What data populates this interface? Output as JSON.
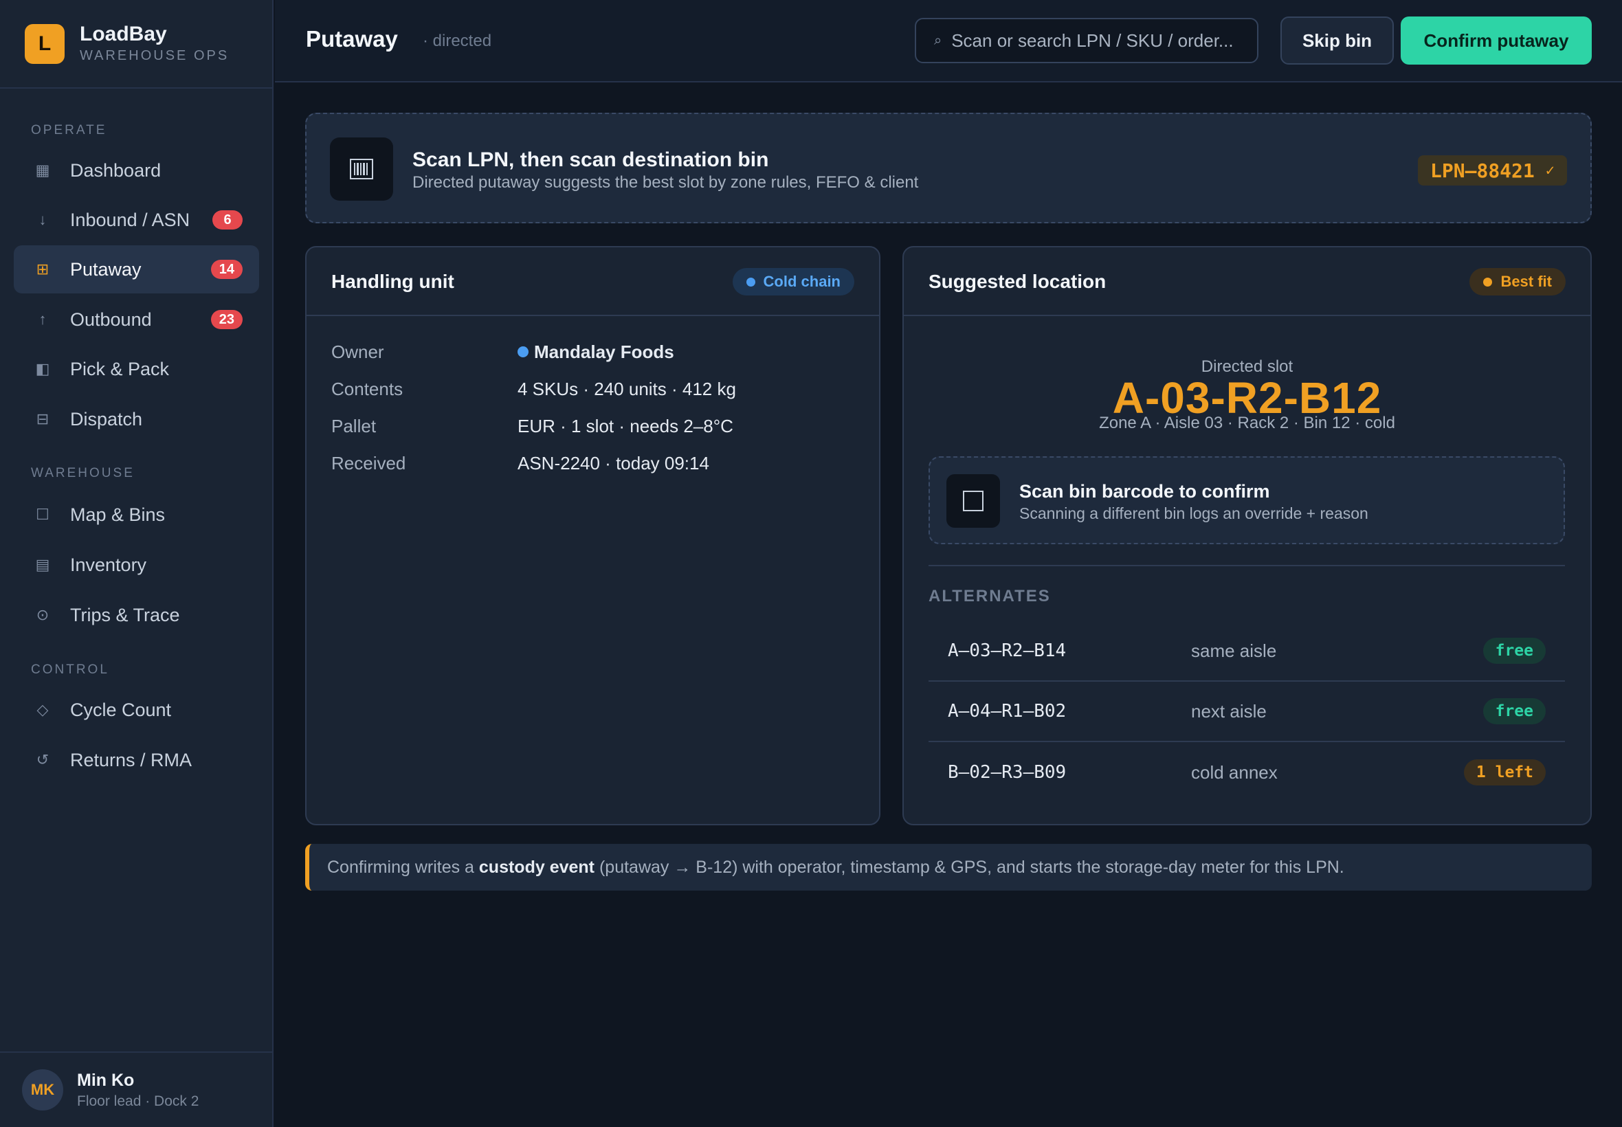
{
  "app": {
    "logo_letter": "L",
    "name": "LoadBay",
    "subtitle": "WAREHOUSE OPS"
  },
  "sidebar": {
    "sections": [
      {
        "label": "OPERATE"
      },
      {
        "label": "WAREHOUSE"
      },
      {
        "label": "CONTROL"
      }
    ],
    "items": [
      {
        "label": "Dashboard",
        "icon": "dashboard-icon",
        "glyph": "▦"
      },
      {
        "label": "Inbound / ASN",
        "icon": "arrow-down-icon",
        "glyph": "↓",
        "badge": "6"
      },
      {
        "label": "Putaway",
        "icon": "grid-icon",
        "glyph": "⊞",
        "badge": "14",
        "active": true
      },
      {
        "label": "Outbound",
        "icon": "arrow-up-icon",
        "glyph": "↑",
        "badge": "23"
      },
      {
        "label": "Pick & Pack",
        "icon": "box-icon",
        "glyph": "◧"
      },
      {
        "label": "Dispatch",
        "icon": "dispatch-icon",
        "glyph": "⊟"
      },
      {
        "label": "Map & Bins",
        "icon": "map-icon",
        "glyph": "☐"
      },
      {
        "label": "Inventory",
        "icon": "inventory-icon",
        "glyph": "▤"
      },
      {
        "label": "Trips & Trace",
        "icon": "trace-icon",
        "glyph": "⊙"
      },
      {
        "label": "Cycle Count",
        "icon": "diamond-icon",
        "glyph": "◇"
      },
      {
        "label": "Returns / RMA",
        "icon": "return-icon",
        "glyph": "↺"
      }
    ]
  },
  "user": {
    "initials": "MK",
    "name": "Min Ko",
    "role": "Floor lead · Dock 2"
  },
  "header": {
    "title": "Putaway",
    "subtitle": "· directed",
    "search_placeholder": "Scan or search LPN / SKU / order...",
    "skip_label": "Skip bin",
    "confirm_label": "Confirm putaway"
  },
  "scan_banner": {
    "title": "Scan LPN, then scan destination bin",
    "description": "Directed putaway suggests the best slot by zone rules, FEFO & client",
    "lpn": "LPN–88421",
    "check": "✓"
  },
  "handling_unit": {
    "title": "Handling unit",
    "badge": "Cold chain",
    "rows": [
      {
        "label": "Owner",
        "value": "Mandalay Foods"
      },
      {
        "label": "Contents",
        "value": "4 SKUs · 240 units · 412 kg"
      },
      {
        "label": "Pallet",
        "value": "EUR · 1 slot · needs 2–8°C"
      },
      {
        "label": "Received",
        "value": "ASN-2240 · today 09:14"
      }
    ]
  },
  "suggested": {
    "title": "Suggested location",
    "badge": "Best fit",
    "slot_label": "Directed slot",
    "slot_code": "A-03-R2-B12",
    "slot_path": "Zone A · Aisle 03 · Rack 2 · Bin 12 · cold",
    "confirm_title": "Scan bin barcode to confirm",
    "confirm_desc": "Scanning a different bin logs an override + reason",
    "alternates_heading": "ALTERNATES",
    "alternates": [
      {
        "code": "A–03–R2–B14",
        "note": "same aisle",
        "status": "free"
      },
      {
        "code": "A–04–R1–B02",
        "note": "next aisle",
        "status": "free"
      },
      {
        "code": "B–02–R3–B09",
        "note": "cold annex",
        "status": "1 left"
      }
    ]
  },
  "footer": {
    "prefix": "Confirming writes a",
    "emphasis": "custody event",
    "suffix": "(putaway → B-12) with operator, timestamp & GPS, and starts the storage-day meter for this LPN."
  },
  "colors": {
    "accent": "#f0a023",
    "primary": "#2dd4a6",
    "badge": "#e5484d",
    "info": "#4b9df2"
  }
}
